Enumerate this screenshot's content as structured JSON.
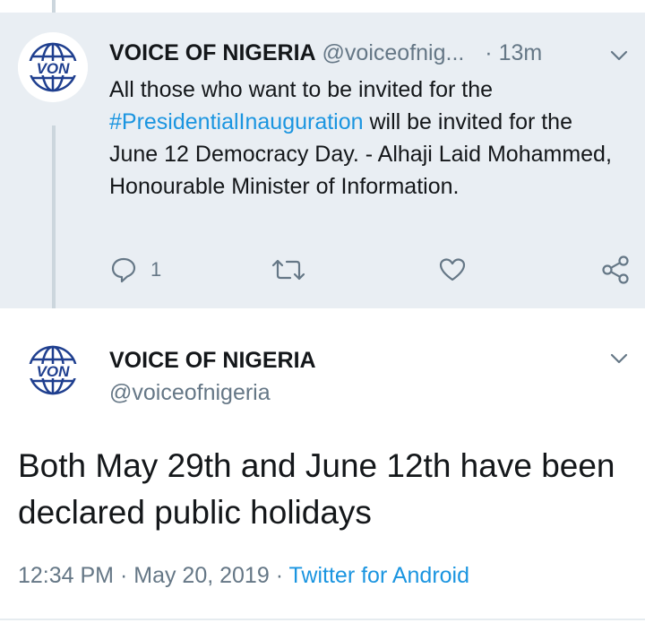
{
  "parent_tweet": {
    "author_name": "VOICE OF NIGERIA",
    "author_handle": "@voiceofnig...",
    "separator": "·",
    "time": "13m",
    "text_before": "All those who want to be invited for the ",
    "hashtag": "#PresidentialInauguration",
    "text_after": " will be invited for the June 12 Democracy Day. - Alhaji Laid Mohammed, Honourable Minister of Information.",
    "reply_count": "1",
    "avatar_text": "VON"
  },
  "main_tweet": {
    "author_name": "VOICE OF NIGERIA",
    "author_handle": "@voiceofnigeria",
    "text": "Both May 29th and June 12th have been declared public holidays",
    "time": "12:34 PM",
    "separator1": "·",
    "date": "May 20, 2019",
    "separator2": "·",
    "source": "Twitter for Android",
    "avatar_text": "VON"
  },
  "colors": {
    "accent": "#1b95e0",
    "muted": "#657786",
    "parent_bg": "#e9eef3",
    "logo_blue": "#1f3f8f"
  },
  "icons": {
    "reply": "reply-icon",
    "retweet": "retweet-icon",
    "like": "heart-icon",
    "share": "share-icon",
    "menu": "chevron-down-icon"
  }
}
